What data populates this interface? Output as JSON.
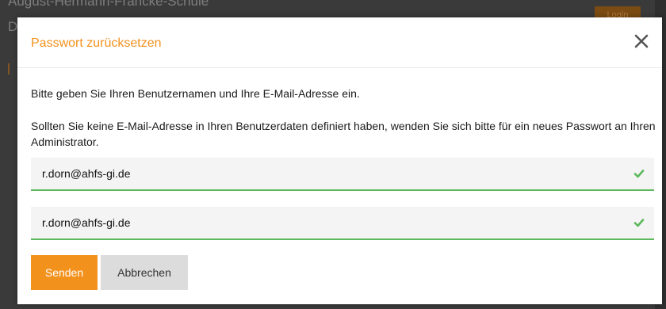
{
  "background": {
    "school_name": "August-Hermann-Francke-Schule",
    "second_line": "D",
    "login_label": "Login"
  },
  "modal": {
    "title": "Passwort zurücksetzen",
    "intro": "Bitte geben Sie Ihren Benutzernamen und Ihre E-Mail-Adresse ein.",
    "hint": "Sollten Sie keine E-Mail-Adresse in Ihren Benutzerdaten definiert haben, wenden Sie sich bitte für ein neues Passwort an Ihren Administrator.",
    "username_field": {
      "value": "r.dorn@ahfs-gi.de"
    },
    "email_field": {
      "value": "r.dorn@ahfs-gi.de"
    },
    "send_label": "Senden",
    "cancel_label": "Abbrechen"
  },
  "colors": {
    "accent": "#f3911d",
    "valid": "#5cb85c",
    "cancel_bg": "#dcdcdc"
  },
  "icons": {
    "close": "close-icon",
    "valid": "checkmark-icon"
  }
}
